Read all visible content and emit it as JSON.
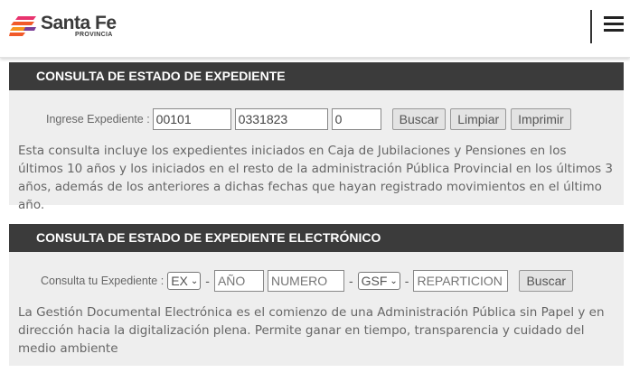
{
  "header": {
    "logo_title": "Santa Fe",
    "logo_subtitle": "PROVINCIA",
    "logo_colors": [
      "#f15a29",
      "#e8336e",
      "#f7941d",
      "#7b3f98"
    ],
    "menu_icon": "hamburger-icon"
  },
  "expediente": {
    "title": "CONSULTA DE ESTADO DE EXPEDIENTE",
    "label": "Ingrese Expediente :",
    "field1": "00101",
    "field2": "0331823",
    "field3": "0",
    "buscar": "Buscar",
    "limpiar": "Limpiar",
    "imprimir": "Imprimir",
    "description": "Esta consulta incluye los expedientes iniciados en Caja de Jubilaciones y Pensiones en los últimos 10 años y los iniciados en el resto de la administración Pública Provincial en los últimos 3 años, además de los anteriores a dichas fechas que hayan registrado movimientos en el último año."
  },
  "electronico": {
    "title": "CONSULTA DE ESTADO DE EXPEDIENTE ELECTRÓNICO",
    "label": "Consulta tu Expediente :",
    "tipo_selected": "EX",
    "anio_placeholder": "AÑO",
    "numero_placeholder": "NUMERO",
    "ecosistema_selected": "GSF",
    "reparticion_placeholder": "REPARTICION",
    "dash": "-",
    "buscar": "Buscar",
    "description": "La Gestión Documental Electrónica es el comienzo de una Administración Pública sin Papel y en dirección hacia la digitalización plena. Permite ganar en tiempo, transparencia y cuidado del medio ambiente"
  }
}
